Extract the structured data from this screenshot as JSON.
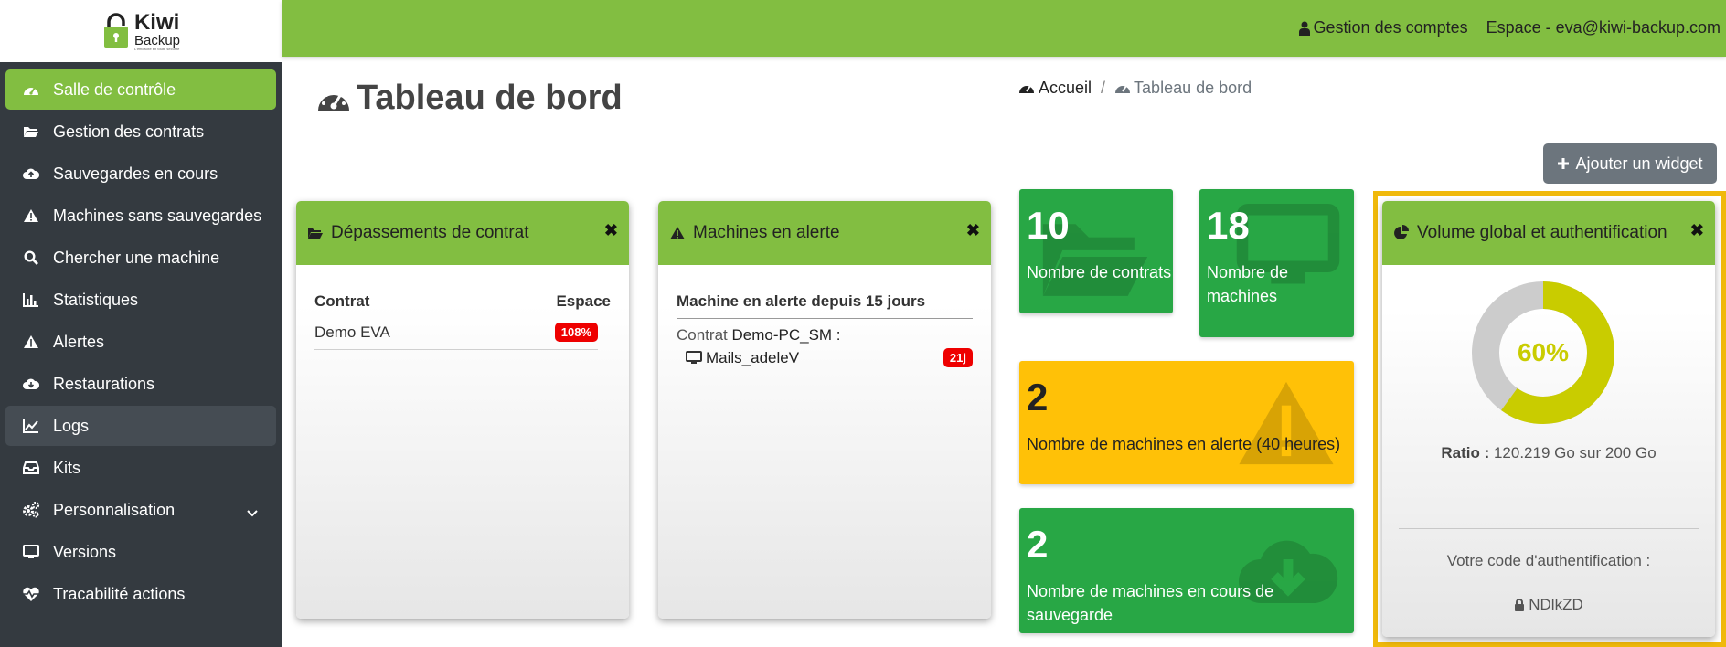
{
  "brand": {
    "name": "Kiwi",
    "sub": "Backup",
    "tagline": "L'efficacité en toute sécurité"
  },
  "sidebar": {
    "items": [
      {
        "label": "Salle de contrôle",
        "icon": "dashboard-icon",
        "active": true
      },
      {
        "label": "Gestion des contrats",
        "icon": "folder-open-icon"
      },
      {
        "label": "Sauvegardes en cours",
        "icon": "cloud-upload-icon"
      },
      {
        "label": "Machines sans sauvegardes",
        "icon": "warning-icon"
      },
      {
        "label": "Chercher une machine",
        "icon": "search-icon"
      },
      {
        "label": "Statistiques",
        "icon": "bar-chart-icon"
      },
      {
        "label": "Alertes",
        "icon": "warning-icon"
      },
      {
        "label": "Restaurations",
        "icon": "cloud-download-icon"
      },
      {
        "label": "Logs",
        "icon": "line-chart-icon",
        "hover": true
      },
      {
        "label": "Kits",
        "icon": "inbox-icon"
      },
      {
        "label": "Personnalisation",
        "icon": "gears-icon",
        "expandable": true
      },
      {
        "label": "Versions",
        "icon": "desktop-icon"
      },
      {
        "label": "Tracabilité actions",
        "icon": "heartbeat-icon"
      }
    ]
  },
  "topbar": {
    "accounts": "Gestion des comptes",
    "space": "Espace - eva@kiwi-backup.com"
  },
  "header": {
    "title": "Tableau de bord",
    "breadcrumb_home": "Accueil",
    "breadcrumb_sep": "/",
    "breadcrumb_current": "Tableau de bord",
    "add_widget": "Ajouter un widget"
  },
  "widgets": {
    "overage": {
      "title": "Dépassements de contrat",
      "col_contract": "Contrat",
      "col_space": "Espace",
      "rows": [
        {
          "contract": "Demo EVA",
          "space": "108%"
        }
      ]
    },
    "alerts": {
      "title": "Machines en alerte",
      "subtitle": "Machine en alerte depuis 15 jours",
      "contract_prefix": "Contrat",
      "contract_name": "Demo-PC_SM :",
      "machine": "Mails_adeleV",
      "days": "21j"
    },
    "volume": {
      "title": "Volume global et authentification",
      "percent_label": "60%",
      "percent": 60,
      "ratio_label": "Ratio :",
      "ratio_value": "120.219 Go sur 200 Go",
      "auth_label": "Votre code d'authentification :",
      "auth_code": "NDlkZD"
    }
  },
  "tiles": {
    "contracts": {
      "value": "10",
      "label": "Nombre de contrats"
    },
    "machines": {
      "value": "18",
      "label_1": "Nombre de",
      "label_2": "machines"
    },
    "alert_machines": {
      "value": "2",
      "label": "Nombre de machines en alerte (40 heures)"
    },
    "running_backups": {
      "value": "2",
      "label": "Nombre de machines en cours de sauvegarde"
    }
  },
  "colors": {
    "brand_green": "#82be41",
    "sidebar_bg": "#343a40",
    "tile_green": "#28a745",
    "tile_yellow": "#ffc107",
    "badge_red": "#ee0000",
    "donut_fill": "#c9cc00",
    "donut_track": "#cccccc",
    "highlight_frame": "#f0b90b"
  }
}
